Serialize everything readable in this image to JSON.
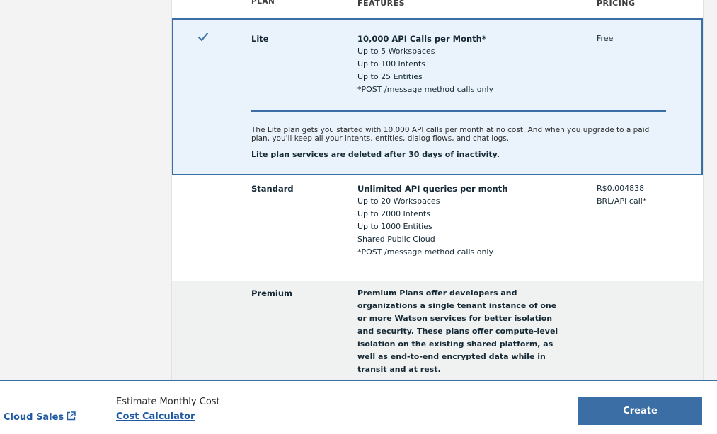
{
  "headers": {
    "plan": "PLAN",
    "features": "FEATURES",
    "pricing": "PRICING"
  },
  "plans": {
    "lite": {
      "name": "Lite",
      "selected": true,
      "features": [
        "10,000 API Calls per Month*",
        "Up to 5 Workspaces",
        "Up to 100 Intents",
        "Up to 25 Entities",
        "*POST /message method calls only"
      ],
      "pricing": "Free",
      "description": "The Lite plan gets you started with 10,000 API calls per month at no cost. And when you upgrade to a paid plan, you'll keep all your intents, entities, dialog flows, and chat logs.",
      "note": "Lite plan services are deleted after 30 days of inactivity."
    },
    "standard": {
      "name": "Standard",
      "features": [
        "Unlimited API queries per month",
        "Up to 20 Workspaces",
        "Up to 2000 Intents",
        "Up to 1000 Entities",
        "Shared Public Cloud",
        "*POST /message method calls only"
      ],
      "pricing": [
        "R$0.004838",
        "BRL/API call*"
      ]
    },
    "premium": {
      "name": "Premium",
      "features_text": "Premium Plans offer developers and organizations a single tenant instance of one or more Watson services for better isolation and security. These plans offer compute-level isolation on the existing shared platform, as well as end-to-end encrypted data while in transit and at rest."
    }
  },
  "footer": {
    "sales_link": "l Cloud Sales",
    "estimate_label": "Estimate Monthly Cost",
    "calculator_link": "Cost Calculator",
    "create_button": "Create"
  },
  "colors": {
    "accent": "#3a6ea5",
    "link": "#1f5aa3",
    "selected_bg": "#eaf3fb"
  }
}
